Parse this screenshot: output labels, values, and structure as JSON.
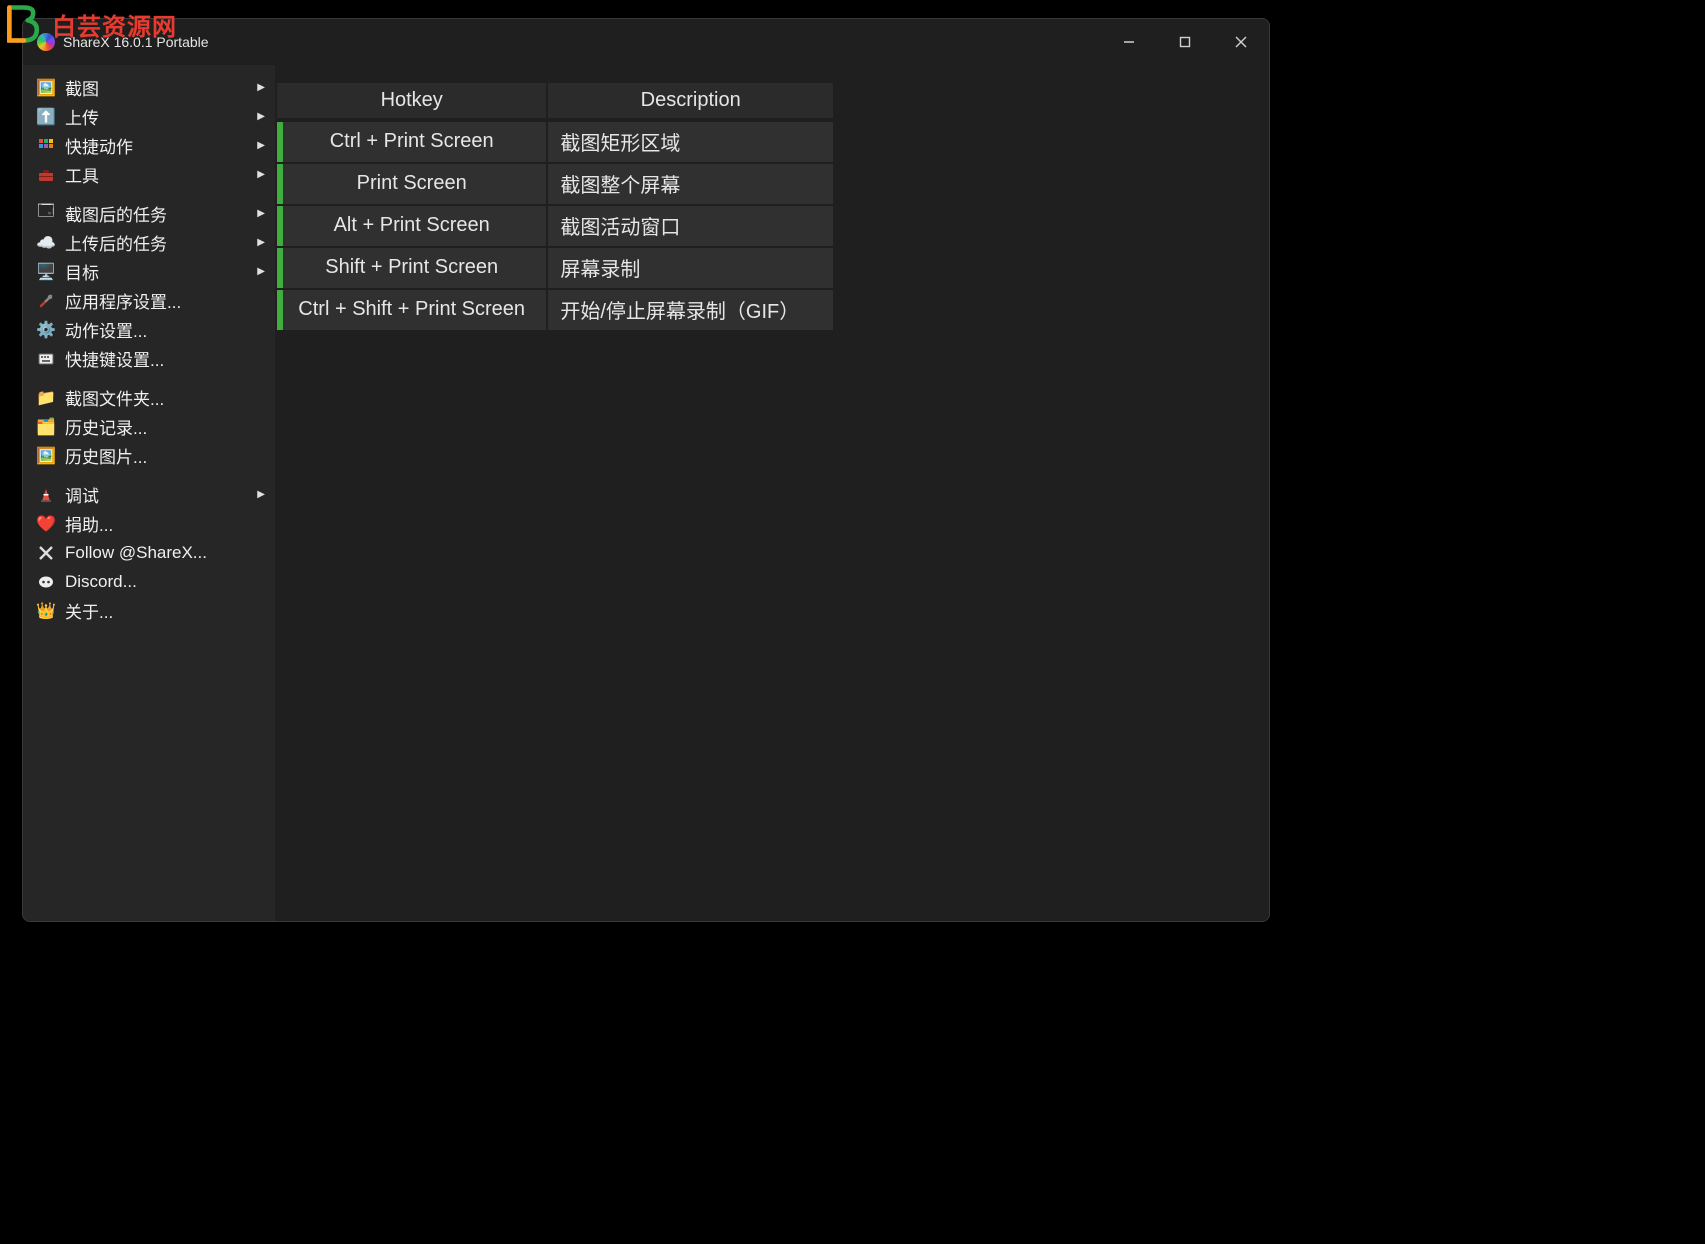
{
  "watermark": {
    "zh": "白芸资源网"
  },
  "window": {
    "title": "ShareX 16.0.1 Portable"
  },
  "sidebar": {
    "groups": [
      [
        {
          "icon": "🖼️",
          "label": "截图",
          "sub": true,
          "name": "menu-capture"
        },
        {
          "icon": "⬆️",
          "label": "上传",
          "sub": true,
          "name": "menu-upload"
        },
        {
          "icon": "🔳",
          "label": "快捷动作",
          "sub": true,
          "name": "menu-quick-actions",
          "iconClass": "grid"
        },
        {
          "icon": "🧰",
          "label": "工具",
          "sub": true,
          "name": "menu-tools",
          "toolbox": true
        }
      ],
      [
        {
          "icon": "🗔",
          "label": "截图后的任务",
          "sub": true,
          "name": "menu-after-capture"
        },
        {
          "icon": "☁️",
          "label": "上传后的任务",
          "sub": true,
          "name": "menu-after-upload"
        },
        {
          "icon": "🖥️",
          "label": "目标",
          "sub": true,
          "name": "menu-destinations"
        },
        {
          "icon": "🛠️",
          "label": "应用程序设置...",
          "sub": false,
          "name": "menu-app-settings",
          "wrench": true
        },
        {
          "icon": "⚙️",
          "label": "动作设置...",
          "sub": false,
          "name": "menu-task-settings"
        },
        {
          "icon": "⌨️",
          "label": "快捷键设置...",
          "sub": false,
          "name": "menu-hotkey-settings",
          "keybox": true
        }
      ],
      [
        {
          "icon": "📁",
          "label": "截图文件夹...",
          "sub": false,
          "name": "menu-screenshot-folder"
        },
        {
          "icon": "🗂️",
          "label": "历史记录...",
          "sub": false,
          "name": "menu-history"
        },
        {
          "icon": "🖼️",
          "label": "历史图片...",
          "sub": false,
          "name": "menu-image-history"
        }
      ],
      [
        {
          "icon": "🚧",
          "label": "调试",
          "sub": true,
          "name": "menu-debug",
          "cone": true
        },
        {
          "icon": "❤️",
          "label": "捐助...",
          "sub": false,
          "name": "menu-donate"
        },
        {
          "icon": "✕",
          "label": "Follow @ShareX...",
          "sub": false,
          "name": "menu-follow",
          "xlogo": true
        },
        {
          "icon": "💬",
          "label": "Discord...",
          "sub": false,
          "name": "menu-discord",
          "discord": true
        },
        {
          "icon": "👑",
          "label": "关于...",
          "sub": false,
          "name": "menu-about"
        }
      ]
    ]
  },
  "hotkeys": {
    "headers": {
      "hotkey": "Hotkey",
      "description": "Description"
    },
    "rows": [
      {
        "hk": "Ctrl + Print Screen",
        "desc": "截图矩形区域"
      },
      {
        "hk": "Print Screen",
        "desc": "截图整个屏幕"
      },
      {
        "hk": "Alt + Print Screen",
        "desc": "截图活动窗口"
      },
      {
        "hk": "Shift + Print Screen",
        "desc": "屏幕录制"
      },
      {
        "hk": "Ctrl + Shift + Print Screen",
        "desc": "开始/停止屏幕录制（GIF）"
      }
    ]
  }
}
